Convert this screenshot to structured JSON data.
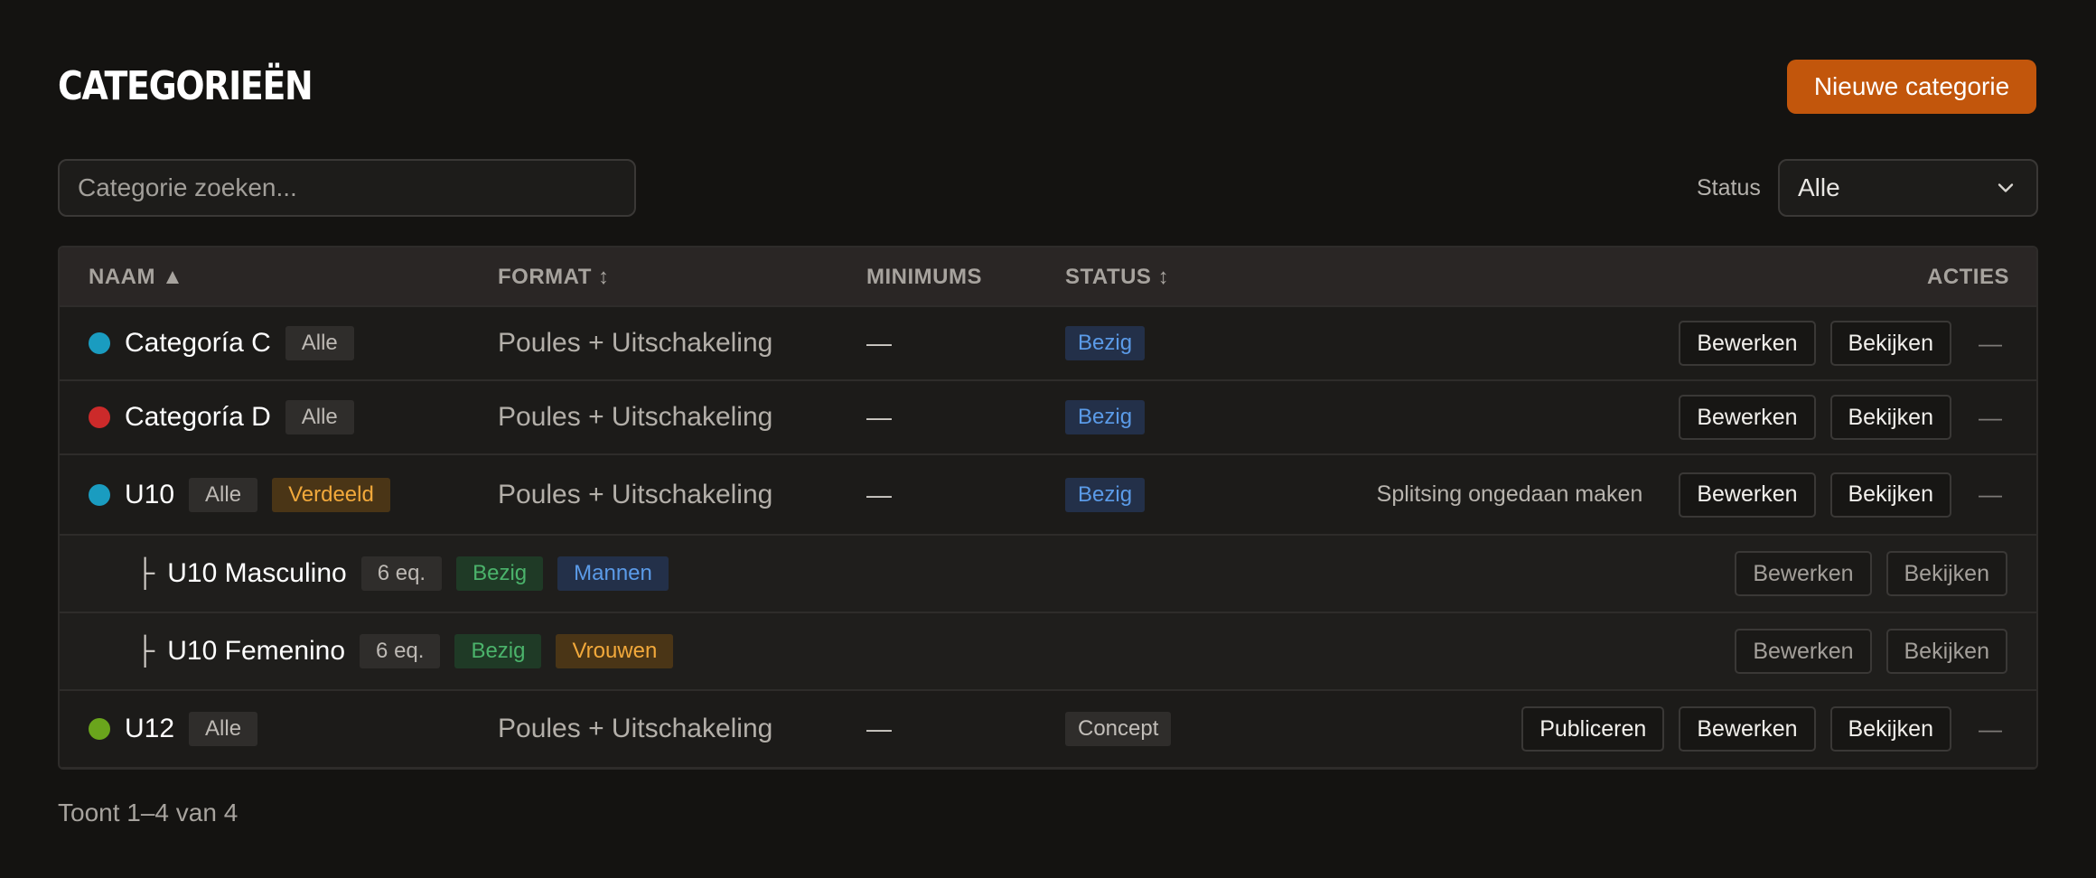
{
  "header": {
    "title": "CATEGORIEËN",
    "new_button": "Nieuwe categorie"
  },
  "filters": {
    "search_placeholder": "Categorie zoeken...",
    "status_label": "Status",
    "status_value": "Alle"
  },
  "table": {
    "columns": {
      "name": "NAAM ▲",
      "format": "FORMAT ↕",
      "minimums": "MINIMUMS",
      "status": "STATUS ↕",
      "actions": "ACTIES"
    },
    "rows": [
      {
        "name": "Categoría C",
        "dot_color": "#1a9cc0",
        "chips": [
          {
            "label": "Alle",
            "kind": "grey"
          }
        ],
        "format": "Poules + Uitschakeling",
        "minimums": "—",
        "status": "Bezig",
        "status_kind": "blue",
        "extra": "",
        "publish": "",
        "edit": "Bewerken",
        "view": "Bekijken",
        "more": "—"
      },
      {
        "name": "Categoría D",
        "dot_color": "#cc2a2a",
        "chips": [
          {
            "label": "Alle",
            "kind": "grey"
          }
        ],
        "format": "Poules + Uitschakeling",
        "minimums": "—",
        "status": "Bezig",
        "status_kind": "blue",
        "extra": "",
        "publish": "",
        "edit": "Bewerken",
        "view": "Bekijken",
        "more": "—"
      },
      {
        "name": "U10",
        "dot_color": "#1a9cc0",
        "chips": [
          {
            "label": "Alle",
            "kind": "grey"
          },
          {
            "label": "Verdeeld",
            "kind": "amber"
          }
        ],
        "format": "Poules + Uitschakeling",
        "minimums": "—",
        "status": "Bezig",
        "status_kind": "blue",
        "extra": "Splitsing ongedaan maken",
        "publish": "",
        "edit": "Bewerken",
        "view": "Bekijken",
        "more": "—"
      },
      {
        "sub": true,
        "tree": "├",
        "name": "U10 Masculino",
        "chips": [
          {
            "label": "6 eq.",
            "kind": "grey"
          },
          {
            "label": "Bezig",
            "kind": "green"
          },
          {
            "label": "Mannen",
            "kind": "blue"
          }
        ],
        "edit": "Bewerken",
        "view": "Bekijken"
      },
      {
        "sub": true,
        "tree": "├",
        "name": "U10 Femenino",
        "chips": [
          {
            "label": "6 eq.",
            "kind": "grey"
          },
          {
            "label": "Bezig",
            "kind": "green"
          },
          {
            "label": "Vrouwen",
            "kind": "amber"
          }
        ],
        "edit": "Bewerken",
        "view": "Bekijken"
      },
      {
        "name": "U12",
        "dot_color": "#6aa51c",
        "chips": [
          {
            "label": "Alle",
            "kind": "grey"
          }
        ],
        "format": "Poules + Uitschakeling",
        "minimums": "—",
        "status": "Concept",
        "status_kind": "grey",
        "extra": "",
        "publish": "Publiceren",
        "edit": "Bewerken",
        "view": "Bekijken",
        "more": "—"
      }
    ]
  },
  "footer": {
    "summary": "Toont 1–4 van 4"
  }
}
